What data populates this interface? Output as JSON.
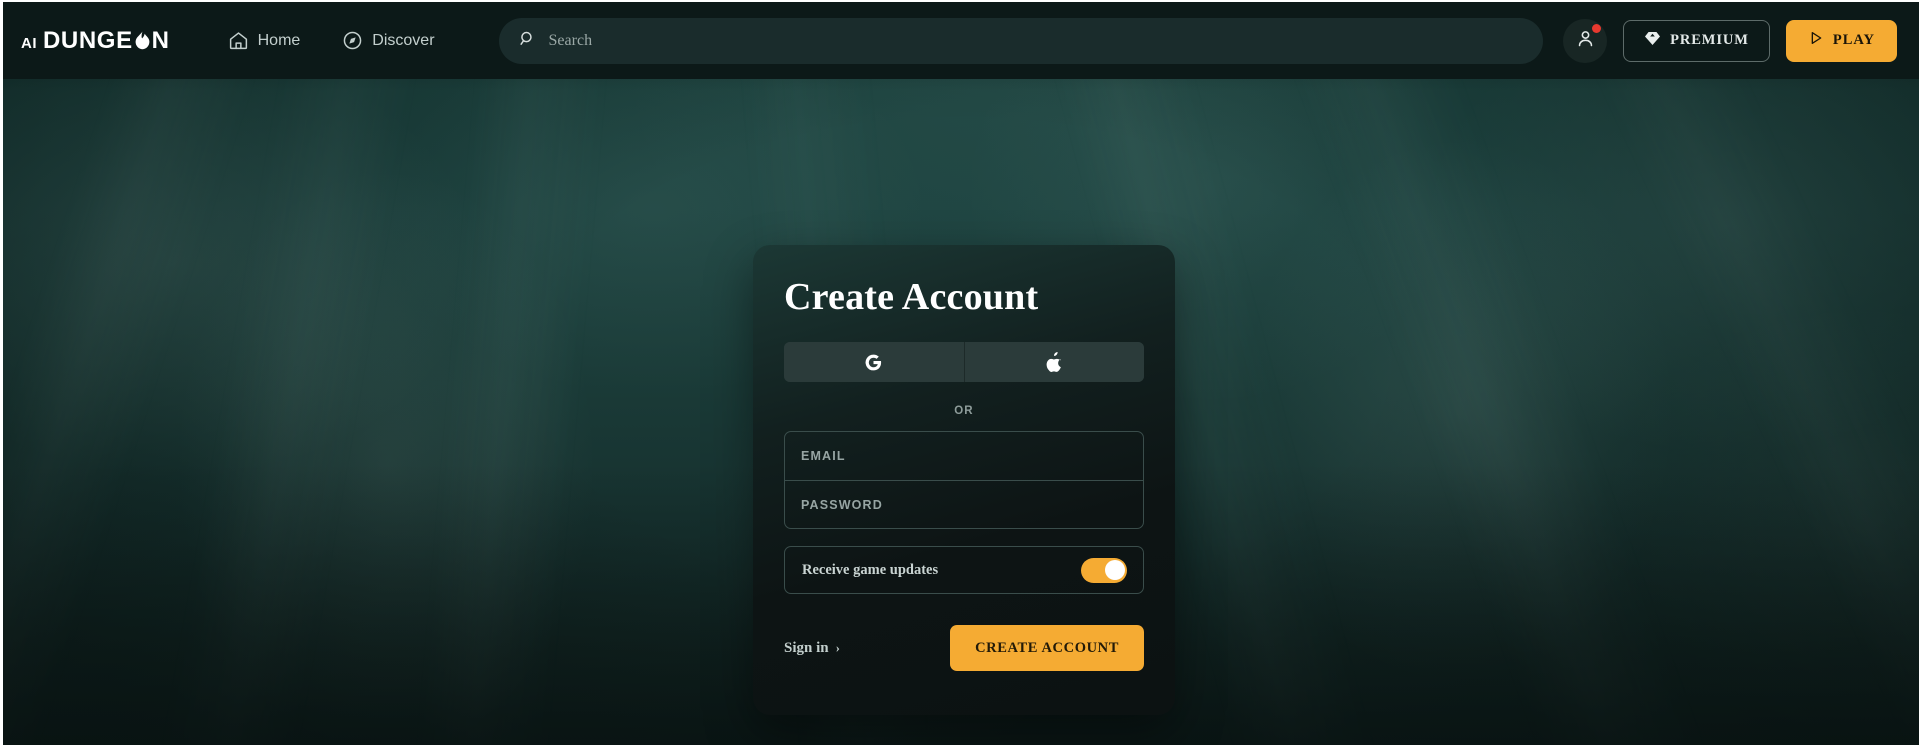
{
  "header": {
    "logo": {
      "prefix": "AI",
      "word_start": "DUNGE",
      "word_end": "N",
      "icon": "flame-icon"
    },
    "nav": [
      {
        "label": "Home",
        "icon": "home-icon"
      },
      {
        "label": "Discover",
        "icon": "compass-icon"
      }
    ],
    "search": {
      "placeholder": "Search",
      "value": "",
      "icon": "search-icon"
    },
    "avatar": {
      "icon": "user-icon",
      "notification": true
    },
    "premium_button": {
      "label": "PREMIUM",
      "icon": "diamond-icon"
    },
    "play_button": {
      "label": "PLAY",
      "icon": "play-icon"
    }
  },
  "auth_card": {
    "title": "Create Account",
    "oauth": [
      {
        "provider": "google",
        "icon": "google-g-icon"
      },
      {
        "provider": "apple",
        "icon": "apple-icon"
      }
    ],
    "divider_label": "OR",
    "fields": [
      {
        "name": "email",
        "placeholder": "EMAIL",
        "value": "",
        "type": "email"
      },
      {
        "name": "password",
        "placeholder": "PASSWORD",
        "value": "",
        "type": "password"
      }
    ],
    "toggle": {
      "label": "Receive game updates",
      "checked": true
    },
    "signin_link": {
      "label": "Sign in",
      "chevron": "›"
    },
    "submit_button": {
      "label": "CREATE ACCOUNT"
    }
  },
  "colors": {
    "accent": "#F5AB33",
    "header_bg": "#0C1918",
    "card_bg": "#0F1616",
    "background_teal": "#1D4440",
    "notification_red": "#E8392F",
    "oauth_bg": "#2B3B3A",
    "border": "#3A4D4B"
  }
}
